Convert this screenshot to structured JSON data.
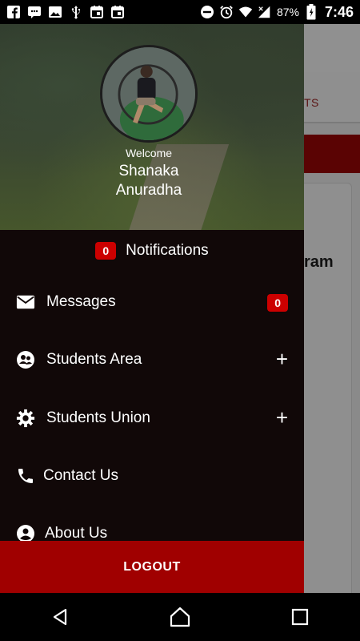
{
  "status_bar": {
    "battery": "87%",
    "time": "7:46",
    "left_icons": [
      "facebook-icon",
      "messenger-icon",
      "image-icon",
      "usb-icon",
      "calendar-icon",
      "calendar-icon"
    ],
    "right_icons": [
      "do-not-disturb-icon",
      "alarm-icon",
      "wifi-icon",
      "signal-icon",
      "battery-icon"
    ]
  },
  "background_app": {
    "tab_label": "TS",
    "card_text": "ram"
  },
  "drawer": {
    "welcome": "Welcome",
    "user_name": "Shanaka\nAnuradha",
    "notifications": {
      "count": "0",
      "label": "Notifications"
    },
    "menu": [
      {
        "label": "Messages",
        "icon": "mail-icon",
        "badge": "0"
      },
      {
        "label": "Students Area",
        "icon": "students-area-icon",
        "expand": "+"
      },
      {
        "label": "Students Union",
        "icon": "gear-icon",
        "expand": "+"
      },
      {
        "label": "Contact Us",
        "icon": "phone-icon"
      },
      {
        "label": "About Us",
        "icon": "account-circle-icon"
      }
    ],
    "logout_label": "LOGOUT"
  },
  "colors": {
    "accent": "#a00000",
    "badge": "#cc0000",
    "drawer_bg": "#110808"
  }
}
